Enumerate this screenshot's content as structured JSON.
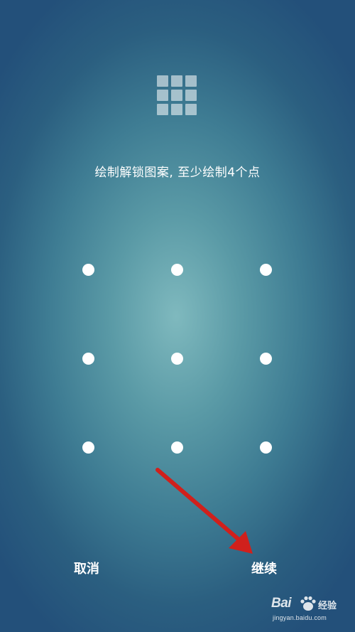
{
  "header": {
    "icon": "grid-icon",
    "instruction": "绘制解锁图案, 至少绘制4个点"
  },
  "pattern": {
    "rows": 3,
    "cols": 3,
    "dot_color": "#ffffff"
  },
  "actions": {
    "cancel_label": "取消",
    "continue_label": "继续"
  },
  "annotation": {
    "icon": "arrow-icon",
    "color": "#d0201c"
  },
  "watermark": {
    "brand_prefix": "Bai",
    "brand_suffix": "经验",
    "url": "jingyan.baidu.com"
  },
  "colors": {
    "background_center": "#7fb9be",
    "background_edge": "#23507a",
    "text": "#ffffff"
  }
}
